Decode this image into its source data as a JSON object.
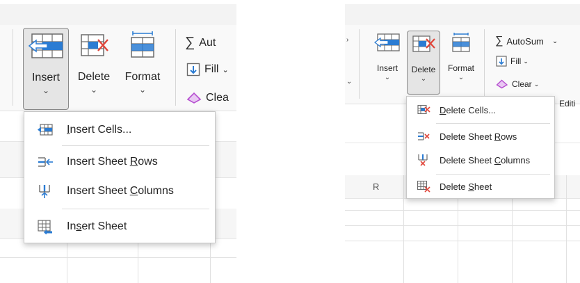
{
  "left": {
    "ribbon": {
      "insert_label": "Insert",
      "delete_label": "Delete",
      "format_label": "Format",
      "autosum_label": "Aut",
      "fill_label": "Fill",
      "clear_label": "Clea"
    },
    "menu": {
      "items": [
        {
          "pre": "",
          "key": "I",
          "post": "nsert Cells..."
        },
        {
          "pre": "Insert Sheet ",
          "key": "R",
          "post": "ows"
        },
        {
          "pre": "Insert Sheet ",
          "key": "C",
          "post": "olumns"
        },
        {
          "pre": "In",
          "key": "s",
          "post": "ert Sheet"
        }
      ]
    }
  },
  "right": {
    "ribbon": {
      "insert_label": "Insert",
      "delete_label": "Delete",
      "format_label": "Format",
      "autosum_label": "AutoSum",
      "fill_label": "Fill",
      "clear_label": "Clear",
      "editing_label": "Editi"
    },
    "column_header": "R",
    "menu": {
      "items": [
        {
          "pre": "",
          "key": "D",
          "post": "elete Cells..."
        },
        {
          "pre": "Delete Sheet ",
          "key": "R",
          "post": "ows"
        },
        {
          "pre": "Delete Sheet ",
          "key": "C",
          "post": "olumns"
        },
        {
          "pre": "Delete ",
          "key": "S",
          "post": "heet"
        }
      ]
    }
  },
  "colors": {
    "accent_blue": "#2b7cd3",
    "accent_red": "#e0453a",
    "clear_magenta": "#b64fd0"
  }
}
